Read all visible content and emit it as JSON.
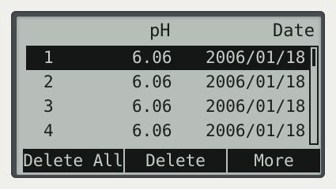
{
  "header": {
    "ph_label": "pH",
    "date_label": "Date"
  },
  "records": [
    {
      "index": "1",
      "ph": "6.06",
      "date": "2006/01/18",
      "selected": true
    },
    {
      "index": "2",
      "ph": "6.06",
      "date": "2006/01/18",
      "selected": false
    },
    {
      "index": "3",
      "ph": "6.06",
      "date": "2006/01/18",
      "selected": false
    },
    {
      "index": "4",
      "ph": "6.06",
      "date": "2006/01/18",
      "selected": false
    }
  ],
  "softkeys": {
    "delete_all_label": "Delete All",
    "delete_label": "Delete",
    "more_label": "More"
  },
  "scroll": {
    "position_fraction": 0.0
  },
  "colors": {
    "lcd_background": "#b7beb9",
    "lcd_ink": "#1b1c1c",
    "bezel": "#4a4d50"
  }
}
